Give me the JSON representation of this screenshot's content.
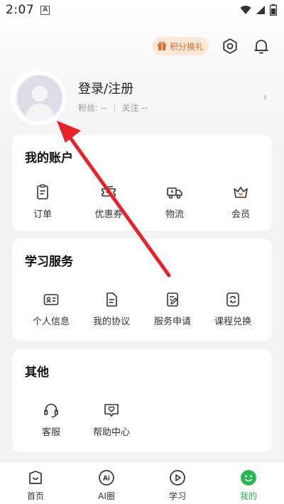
{
  "status_bar": {
    "time": "2:07",
    "notif_icon_letter": "A"
  },
  "header": {
    "points_label": "积分换礼"
  },
  "profile": {
    "name": "登录/注册",
    "followers_label": "粉丝: --",
    "following_label": "关注 --"
  },
  "account": {
    "title": "我的账户",
    "items": [
      {
        "label": "订单",
        "icon": "clipboard-icon"
      },
      {
        "label": "优惠券",
        "icon": "coupon-icon"
      },
      {
        "label": "物流",
        "icon": "truck-icon"
      },
      {
        "label": "会员",
        "icon": "crown-icon"
      }
    ]
  },
  "study": {
    "title": "学习服务",
    "items": [
      {
        "label": "个人信息",
        "icon": "id-card-icon"
      },
      {
        "label": "我的协议",
        "icon": "document-icon"
      },
      {
        "label": "服务申请",
        "icon": "edit-document-icon"
      },
      {
        "label": "课程兑换",
        "icon": "exchange-icon"
      }
    ]
  },
  "other": {
    "title": "其他",
    "items": [
      {
        "label": "客服",
        "icon": "headset-icon"
      },
      {
        "label": "帮助中心",
        "icon": "help-heart-icon"
      }
    ]
  },
  "bottom_nav": {
    "items": [
      {
        "label": "首页",
        "icon": "home-icon"
      },
      {
        "label": "AI圈",
        "icon": "ai-circle-icon"
      },
      {
        "label": "学习",
        "icon": "play-icon"
      },
      {
        "label": "我的",
        "icon": "smiley-icon"
      }
    ],
    "active": "我的"
  },
  "colors": {
    "accent": "#2cb553",
    "points_text": "#e36b2c",
    "points_bg": "#fbe8d8",
    "arrow": "#e8202a"
  }
}
